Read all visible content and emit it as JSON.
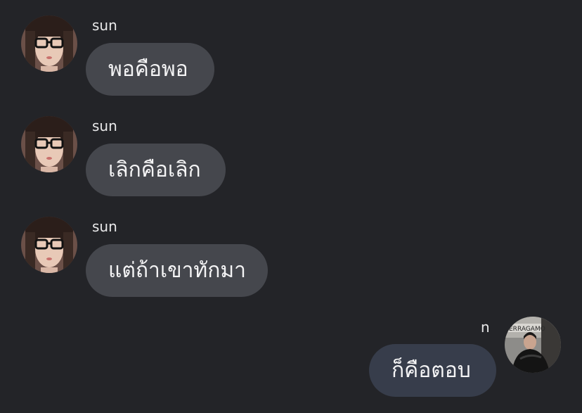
{
  "messages": [
    {
      "sender": "sun",
      "text": "พอคือพอ",
      "direction": "incoming",
      "avatar": "avatar-woman-glasses"
    },
    {
      "sender": "sun",
      "text": "เลิกคือเลิก",
      "direction": "incoming",
      "avatar": "avatar-woman-glasses"
    },
    {
      "sender": "sun",
      "text": "แต่ถ้าเขาทักมา",
      "direction": "incoming",
      "avatar": "avatar-woman-glasses"
    },
    {
      "sender": "n",
      "text": "ก็คือตอบ",
      "direction": "outgoing",
      "avatar": "avatar-man-leather-jacket"
    }
  ],
  "colors": {
    "background": "#232428",
    "incoming_bubble": "#45474d",
    "outgoing_bubble": "#373d4b",
    "text": "#f4f4f5"
  }
}
